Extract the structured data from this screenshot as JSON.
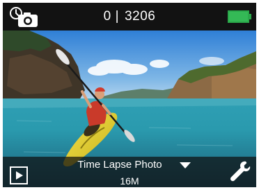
{
  "status_bar": {
    "mode_icon": "timelapse-photo-camera-icon",
    "shots_taken": "0",
    "separator": "|",
    "shots_remaining": "3206",
    "battery_icon": "battery-full-icon",
    "battery_color": "#34b956"
  },
  "preview": {
    "subject": "kayaker-on-lake"
  },
  "bottom_bar": {
    "playback_icon": "playback-icon",
    "mode_label": "Time Lapse Photo",
    "mode_dropdown_icon": "chevron-down-icon",
    "resolution": "16M",
    "settings_icon": "wrench-icon"
  }
}
